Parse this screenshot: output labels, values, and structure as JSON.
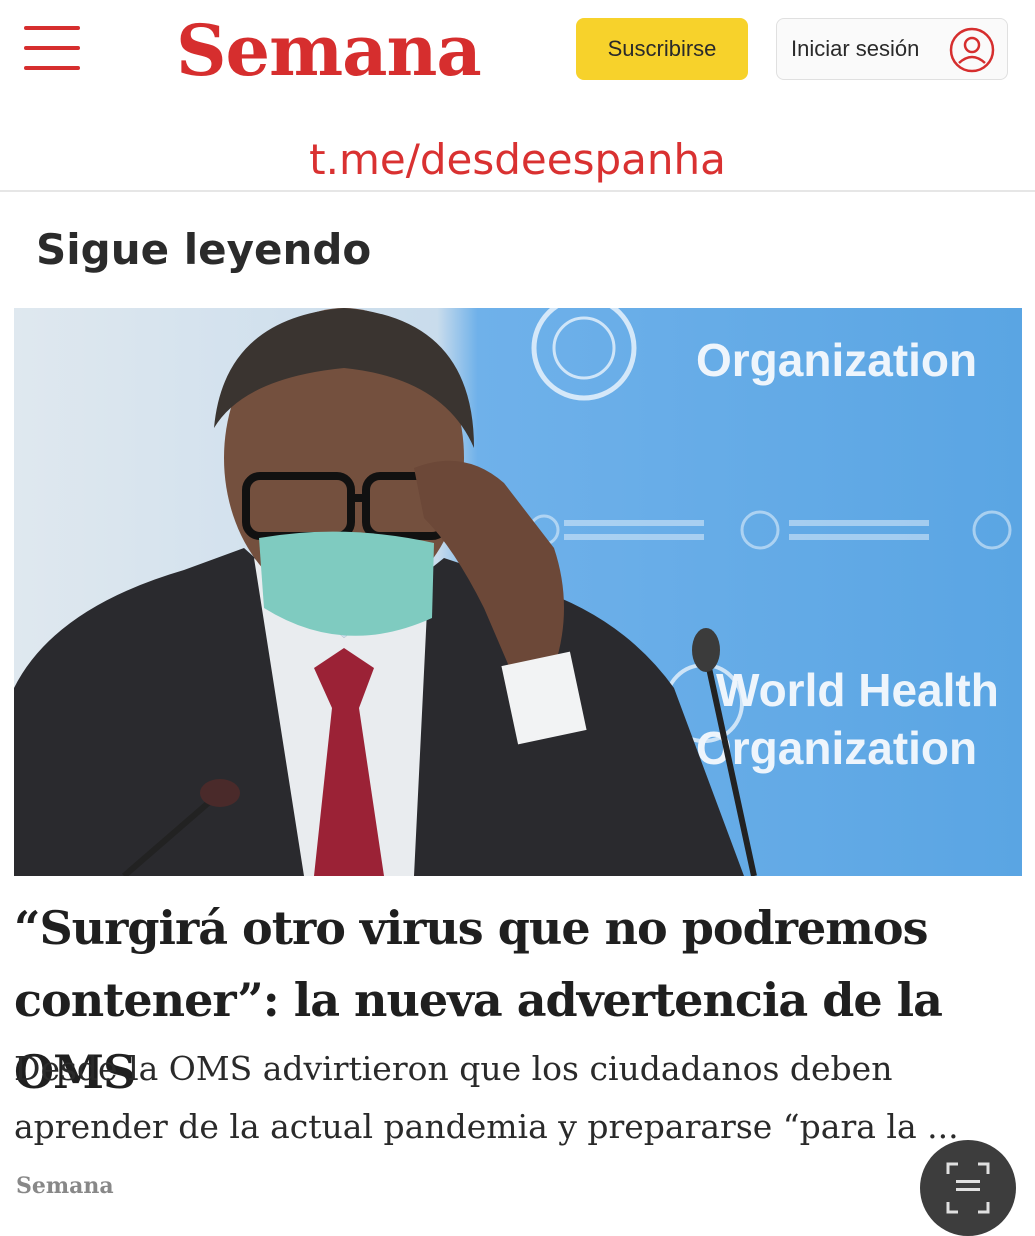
{
  "header": {
    "logo": "Semana",
    "subscribe_label": "Suscribirse",
    "login_label": "Iniciar sesión"
  },
  "watermark": "t.me/desdeespanha",
  "section_title": "Sigue leyendo",
  "photo": {
    "backdrop_text_top": "Organization",
    "backdrop_text_line1": "World Health",
    "backdrop_text_line2": "Organization"
  },
  "article": {
    "headline": "“Surgirá otro virus que no podremos contener”: la nueva advertencia de la OMS",
    "summary": "Desde la OMS advirtieron que los ciudadanos deben aprender de la actual pandemia y prepararse “para la ...",
    "source": "Semana"
  },
  "colors": {
    "brand_red": "#d62e2e",
    "subscribe_yellow": "#f7d22b",
    "backdrop_blue": "#5fa8e6"
  },
  "icons": {
    "menu": "hamburger-menu-icon",
    "user": "user-circle-icon",
    "fab": "scan-text-icon"
  }
}
